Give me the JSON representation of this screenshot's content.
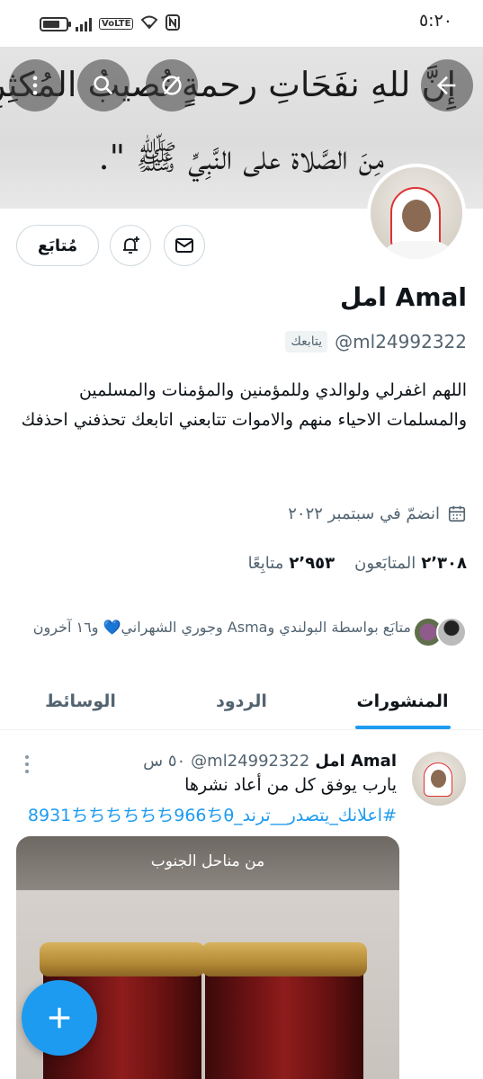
{
  "status_bar": {
    "time": "٥:٢٠",
    "volte": "VoLTE"
  },
  "banner": {
    "line1": "إِنَّ للهِ نفَحَاتِ رحمةٍ تُصيبُ المُكثِرِينَ",
    "line2": "مِنَ الصَّلاة على النَّبِيِّ ﷺ \"."
  },
  "profile": {
    "name": "امل Amal",
    "handle": "@ml24992322",
    "follows_you": "يتابعك",
    "follow_button": "مُتابَع",
    "bio": "اللهم اغفرلي ولوالدي وللمؤمنين والمؤمنات والمسلمين والمسلمات الاحياء منهم والاموات تتابعني اتابعك تحذفني احذفك",
    "joined": "انضمّ في سبتمبر ٢٠٢٢",
    "followers_count": "٢٬٣٠٨",
    "followers_label": "المتابَعون",
    "following_count": "٢٬٩٥٣",
    "following_label": "متابِعًا",
    "followed_by": "متابَع بواسطة البولندي وAsma وجوري الشهراني💙 و١٦ آخرون"
  },
  "tabs": [
    {
      "label": "المنشورات",
      "active": true
    },
    {
      "label": "الردود",
      "active": false
    },
    {
      "label": "الوسائط",
      "active": false
    }
  ],
  "post": {
    "name": "امل Amal",
    "handle": "@ml24992322",
    "time": "٥٠ س",
    "text": "يارب يوفق كل من أعاد نشرها",
    "hashtag": "#اعلانك_يتصدر__ترند_8931ちちちちちち966ちθ",
    "media_caption": "من مناحل الجنوب"
  },
  "colors": {
    "accent": "#1d9bf0",
    "text_primary": "#0f1419",
    "text_secondary": "#536471",
    "border": "#cfd9de"
  }
}
